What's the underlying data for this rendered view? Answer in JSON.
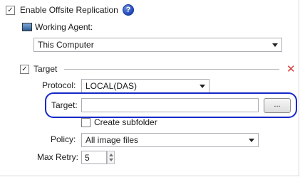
{
  "replication": {
    "enable_label": "Enable Offsite Replication",
    "enabled": true,
    "help_icon": "question-circle-icon",
    "help_glyph": "?"
  },
  "working_agent": {
    "label": "Working Agent:",
    "icon": "computer-monitor-icon",
    "value": "This Computer"
  },
  "target_section": {
    "label": "Target",
    "checked": true,
    "remove_icon": "close-icon",
    "remove_glyph": "✕"
  },
  "protocol": {
    "label": "Protocol:",
    "value": "LOCAL(DAS)"
  },
  "target_path": {
    "label": "Target:",
    "value": "",
    "browse_label": "...",
    "highlight_color": "#1528c9"
  },
  "create_subfolder": {
    "label": "Create subfolder",
    "checked": false
  },
  "policy": {
    "label": "Policy:",
    "value": "All image files"
  },
  "max_retry": {
    "label": "Max Retry:",
    "value": "5"
  },
  "check_glyph": "✓"
}
